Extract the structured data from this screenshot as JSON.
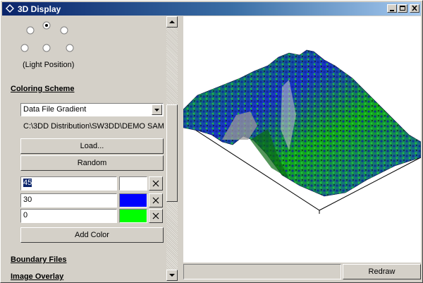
{
  "window": {
    "title": "3D Display"
  },
  "light": {
    "label": "(Light Position)",
    "options": [
      {
        "id": "top-left",
        "checked": false
      },
      {
        "id": "top",
        "checked": true
      },
      {
        "id": "top-right",
        "checked": false
      },
      {
        "id": "bottom-left",
        "checked": false
      },
      {
        "id": "bottom",
        "checked": false
      },
      {
        "id": "bottom-right",
        "checked": false
      }
    ]
  },
  "coloring": {
    "heading": "Coloring Scheme",
    "scheme_selected": "Data File Gradient",
    "file_path": "C:\\3DD Distribution\\SW3DD\\DEMO SAM",
    "load_label": "Load...",
    "random_label": "Random",
    "colors": [
      {
        "value": "45",
        "swatch": "#ffffff"
      },
      {
        "value": "30",
        "swatch": "#0000ff"
      },
      {
        "value": "0",
        "swatch": "#00ff00"
      }
    ],
    "add_color_label": "Add Color"
  },
  "sections": {
    "boundary": "Boundary Files",
    "overlay": "Image Overlay"
  },
  "viewport": {
    "redraw_label": "Redraw"
  }
}
